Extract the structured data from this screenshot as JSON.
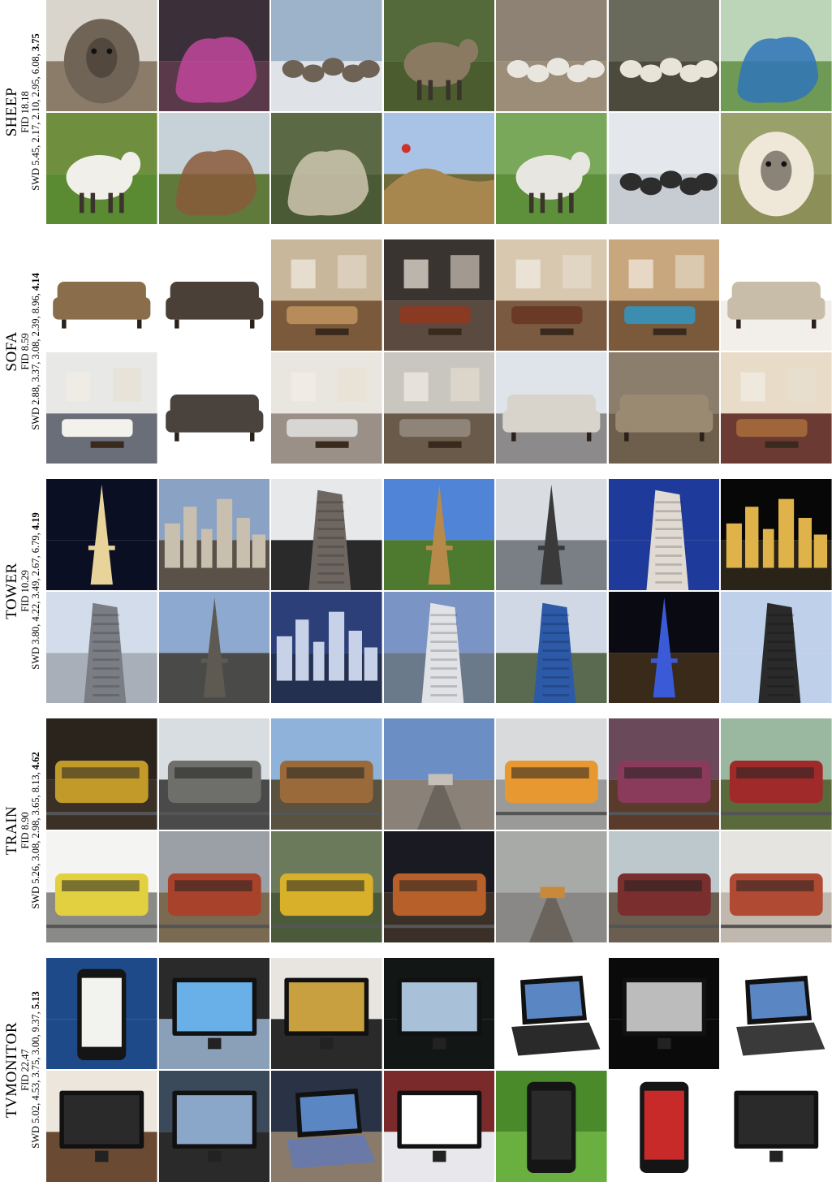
{
  "figure": {
    "blocks": [
      {
        "category": "SHEEP",
        "fid": "FID 18.18",
        "swd_prefix": "SWD 5.45, 2.17, 2.10, 2.95, 6.08, ",
        "swd_bold": "3.75",
        "tiles": [
          {
            "sky": "#d9d4cc",
            "ground": "#8a7c68",
            "subject": "#6f6456",
            "kind": "sheep-face"
          },
          {
            "sky": "#3b2f3a",
            "ground": "#5a3a4a",
            "subject": "#c2479b",
            "kind": "blob"
          },
          {
            "sky": "#9db3c9",
            "ground": "#dfe3e8",
            "subject": "#6e6254",
            "kind": "herd"
          },
          {
            "sky": "#556a3a",
            "ground": "#4b5c2e",
            "subject": "#8a7a62",
            "kind": "sheep"
          },
          {
            "sky": "#8d8274",
            "ground": "#9b8d78",
            "subject": "#e9e6df",
            "kind": "herd"
          },
          {
            "sky": "#6a6a5c",
            "ground": "#4c4a3c",
            "subject": "#e8e4d8",
            "kind": "herd"
          },
          {
            "sky": "#bcd4b8",
            "ground": "#6f9a55",
            "subject": "#2f74b8",
            "kind": "blob"
          },
          {
            "sky": "#6f8f3e",
            "ground": "#5a8a32",
            "subject": "#f0efe9",
            "kind": "sheep"
          },
          {
            "sky": "#c7d2d8",
            "ground": "#5f7a3a",
            "subject": "#8a5a3a",
            "kind": "blob"
          },
          {
            "sky": "#5b6a44",
            "ground": "#4a5a34",
            "subject": "#cfc6b0",
            "kind": "blob"
          },
          {
            "sky": "#a9c3e6",
            "ground": "#6f6a3a",
            "subject": "#a8874f",
            "kind": "hill"
          },
          {
            "sky": "#7aa85a",
            "ground": "#5e8f3a",
            "subject": "#e8e6e0",
            "kind": "sheep"
          },
          {
            "sky": "#e4e8ec",
            "ground": "#c7ccd2",
            "subject": "#2d2d2d",
            "kind": "herd"
          },
          {
            "sky": "#9aa06a",
            "ground": "#8c8f58",
            "subject": "#efe7d8",
            "kind": "sheep-face"
          }
        ]
      },
      {
        "category": "SOFA",
        "fid": "FID 8.59",
        "swd_prefix": "SWD 2.88, 3.37, 3.08, 2.39, 8.96, ",
        "swd_bold": "4.14",
        "tiles": [
          {
            "sky": "#ffffff",
            "ground": "#ffffff",
            "subject": "#8a6e4c",
            "kind": "sofa"
          },
          {
            "sky": "#ffffff",
            "ground": "#ffffff",
            "subject": "#4a4038",
            "kind": "sofa"
          },
          {
            "sky": "#c9b79b",
            "ground": "#7a5a3a",
            "subject": "#b88b5a",
            "kind": "room"
          },
          {
            "sky": "#3a3430",
            "ground": "#5a4a40",
            "subject": "#8a3a22",
            "kind": "room"
          },
          {
            "sky": "#d8c8b0",
            "ground": "#7a5a40",
            "subject": "#6a3a26",
            "kind": "room"
          },
          {
            "sky": "#c9a77e",
            "ground": "#7a5a3a",
            "subject": "#3b8eb0",
            "kind": "room"
          },
          {
            "sky": "#ffffff",
            "ground": "#f2efea",
            "subject": "#c8bda8",
            "kind": "sofa"
          },
          {
            "sky": "#e8e8e6",
            "ground": "#6a6e78",
            "subject": "#f3f1ec",
            "kind": "room"
          },
          {
            "sky": "#ffffff",
            "ground": "#ffffff",
            "subject": "#4a423c",
            "kind": "sofa"
          },
          {
            "sky": "#e9e6e0",
            "ground": "#9a9088",
            "subject": "#d8d6d2",
            "kind": "room"
          },
          {
            "sky": "#c9c6c0",
            "ground": "#6a5a4a",
            "subject": "#8e8478",
            "kind": "room"
          },
          {
            "sky": "#dfe3ea",
            "ground": "#8c8a8a",
            "subject": "#d8d4cc",
            "kind": "sofa"
          },
          {
            "sky": "#8b7e6c",
            "ground": "#6e5e4c",
            "subject": "#9a8a72",
            "kind": "sofa"
          },
          {
            "sky": "#e8dcc8",
            "ground": "#6b3a32",
            "subject": "#a0663a",
            "kind": "room"
          }
        ]
      },
      {
        "category": "TOWER",
        "fid": "FID 10.29",
        "swd_prefix": "SWD 3.80, 4.22, 3.49, 2.67, 6.79, ",
        "swd_bold": "4.19",
        "tiles": [
          {
            "sky": "#0b0f24",
            "ground": "#0b0f24",
            "subject": "#e8d49a",
            "kind": "spire"
          },
          {
            "sky": "#8aa2c4",
            "ground": "#5a5248",
            "subject": "#c8bfae",
            "kind": "city"
          },
          {
            "sky": "#e6e8ea",
            "ground": "#2a2a2a",
            "subject": "#6e6660",
            "kind": "tower"
          },
          {
            "sky": "#4f84d6",
            "ground": "#4d7a2e",
            "subject": "#b88a4a",
            "kind": "spire"
          },
          {
            "sky": "#d9dde2",
            "ground": "#7a7f86",
            "subject": "#3a3a3a",
            "kind": "spire"
          },
          {
            "sky": "#1e3a9a",
            "ground": "#1e3a9a",
            "subject": "#e0dad2",
            "kind": "tower"
          },
          {
            "sky": "#070708",
            "ground": "#2a2418",
            "subject": "#e0b24a",
            "kind": "city"
          },
          {
            "sky": "#d2dcea",
            "ground": "#a9afb8",
            "subject": "#7a7e84",
            "kind": "tower"
          },
          {
            "sky": "#8ea9cf",
            "ground": "#4a4a48",
            "subject": "#5e5a52",
            "kind": "spire"
          },
          {
            "sky": "#2c3f78",
            "ground": "#243050",
            "subject": "#c7d2e8",
            "kind": "city"
          },
          {
            "sky": "#7a94c6",
            "ground": "#6a7a8a",
            "subject": "#e0e2e6",
            "kind": "tower"
          },
          {
            "sky": "#cfd8e4",
            "ground": "#5a6a50",
            "subject": "#2c5aa8",
            "kind": "tower"
          },
          {
            "sky": "#0a0a12",
            "ground": "#3a2a1a",
            "subject": "#3a5ad8",
            "kind": "spire"
          },
          {
            "sky": "#bfd0ea",
            "ground": "#bfd0ea",
            "subject": "#2a2a2a",
            "kind": "tower"
          }
        ]
      },
      {
        "category": "TRAIN",
        "fid": "FID 8.90",
        "swd_prefix": "SWD 5.26, 3.08, 2.98, 3.65, 8.13, ",
        "swd_bold": "4.62",
        "tiles": [
          {
            "sky": "#2a241c",
            "ground": "#3a3026",
            "subject": "#c29a2a",
            "kind": "train"
          },
          {
            "sky": "#d8dde2",
            "ground": "#4a4a4a",
            "subject": "#6e6e6a",
            "kind": "train"
          },
          {
            "sky": "#8eb2da",
            "ground": "#5a5240",
            "subject": "#9a6a3a",
            "kind": "train"
          },
          {
            "sky": "#6b8fc4",
            "ground": "#8a8278",
            "subject": "#c4c0b8",
            "kind": "rails"
          },
          {
            "sky": "#d8dadc",
            "ground": "#9a9a98",
            "subject": "#e89830",
            "kind": "train"
          },
          {
            "sky": "#6a4a5a",
            "ground": "#5a3a2a",
            "subject": "#8a3a5a",
            "kind": "train"
          },
          {
            "sky": "#9ab8a0",
            "ground": "#5a6a3a",
            "subject": "#a02a2a",
            "kind": "train"
          },
          {
            "sky": "#f4f4f2",
            "ground": "#8a8a88",
            "subject": "#e2d040",
            "kind": "train"
          },
          {
            "sky": "#9aa0a6",
            "ground": "#7a6a52",
            "subject": "#a8422a",
            "kind": "train"
          },
          {
            "sky": "#6a7a5a",
            "ground": "#4a5a3a",
            "subject": "#d8b02a",
            "kind": "train"
          },
          {
            "sky": "#1a1a22",
            "ground": "#3a3028",
            "subject": "#b8602a",
            "kind": "train"
          },
          {
            "sky": "#a8aaa8",
            "ground": "#8a8886",
            "subject": "#c88a3a",
            "kind": "rails"
          },
          {
            "sky": "#bcc8cc",
            "ground": "#6a5e50",
            "subject": "#7a2e2e",
            "kind": "train"
          },
          {
            "sky": "#e6e4e0",
            "ground": "#c0b8ae",
            "subject": "#b04a32",
            "kind": "train"
          }
        ]
      },
      {
        "category": "TVMONITOR",
        "fid": "FID 22.47",
        "swd_prefix": "SWD 5.02, 4.53, 3.75, 3.00, 9.37, ",
        "swd_bold": "5.13",
        "tiles": [
          {
            "sky": "#1e4a8a",
            "ground": "#1e4a8a",
            "subject": "#f2f2ee",
            "kind": "phone"
          },
          {
            "sky": "#2a2a2a",
            "ground": "#8aa0b8",
            "subject": "#6ab0e8",
            "kind": "screen"
          },
          {
            "sky": "#e8e4e0",
            "ground": "#2a2a2a",
            "subject": "#c8a040",
            "kind": "screen"
          },
          {
            "sky": "#121614",
            "ground": "#121614",
            "subject": "#a8c0d8",
            "kind": "screen"
          },
          {
            "sky": "#ffffff",
            "ground": "#ffffff",
            "subject": "#2a2a2a",
            "kind": "laptop"
          },
          {
            "sky": "#0a0a0a",
            "ground": "#0a0a0a",
            "subject": "#bcbcbc",
            "kind": "screen"
          },
          {
            "sky": "#ffffff",
            "ground": "#ffffff",
            "subject": "#3a3a3a",
            "kind": "laptop"
          },
          {
            "sky": "#ece6dc",
            "ground": "#6a4a32",
            "subject": "#2a2a2a",
            "kind": "screen"
          },
          {
            "sky": "#3a4a5a",
            "ground": "#2a2a2a",
            "subject": "#8aa6c8",
            "kind": "screen"
          },
          {
            "sky": "#2a3246",
            "ground": "#8a7a6a",
            "subject": "#6a7aa8",
            "kind": "laptop"
          },
          {
            "sky": "#7a2a2a",
            "ground": "#e8e8ec",
            "subject": "#ffffff",
            "kind": "screen"
          },
          {
            "sky": "#4a8a2a",
            "ground": "#6ab040",
            "subject": "#2a2a2a",
            "kind": "phone"
          },
          {
            "sky": "#ffffff",
            "ground": "#ffffff",
            "subject": "#c82a2a",
            "kind": "phone"
          },
          {
            "sky": "#ffffff",
            "ground": "#ffffff",
            "subject": "#2a2a2a",
            "kind": "screen"
          }
        ]
      }
    ]
  }
}
